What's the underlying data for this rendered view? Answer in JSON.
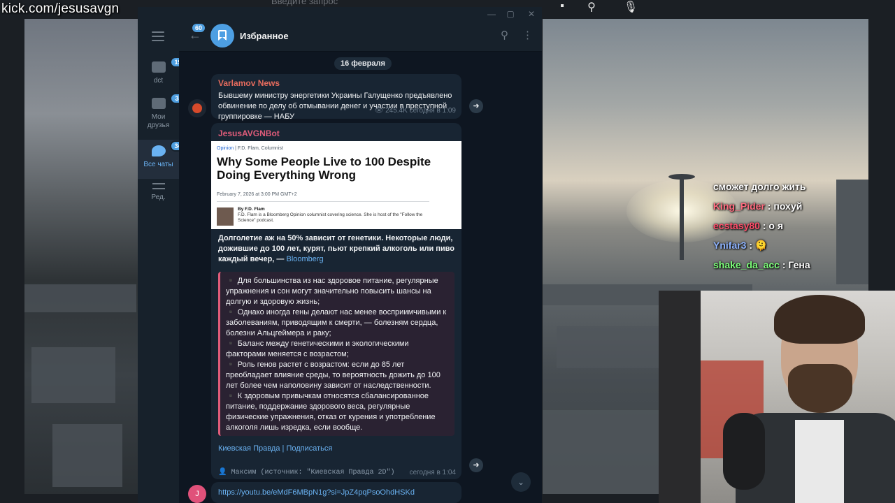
{
  "stream": {
    "watermark": "kick.com/jesusavgn",
    "search_placeholder": "Введите запрос"
  },
  "overlay_chat": {
    "top_line": "сможет долго жить",
    "lines": [
      {
        "user": "King_Pider",
        "sep": " : ",
        "text": "похуй",
        "color": "#ff6b7f"
      },
      {
        "user": "ecstasy80",
        "sep": " : ",
        "text": "о я",
        "color": "#ff4d6a"
      },
      {
        "user": "Ynifar3",
        "sep": " : ",
        "text": "🫠",
        "color": "#8fb4ff"
      },
      {
        "user": "shake_da_acc",
        "sep": " : ",
        "text": "Гена",
        "color": "#7dff7a"
      }
    ]
  },
  "window_controls": {
    "minimize": "—",
    "maximize": "▢",
    "close": "✕"
  },
  "sidebar": {
    "folders": [
      {
        "label": "dct",
        "badge": "190"
      },
      {
        "label": "Мои друзья",
        "badge": "34"
      },
      {
        "label": "Все чаты",
        "badge": "341"
      },
      {
        "label": "Ред.",
        "badge": ""
      }
    ]
  },
  "header": {
    "back_badge": "60",
    "title": "Избранное"
  },
  "messages": {
    "date": "16 февраля",
    "msg1": {
      "sender": "Varlamov News",
      "sender_color": "#e56b5d",
      "text": "Бывшему министру энергетики Украины Галущенко предъявлено обвинение по делу об отмывании денег и участии в преступной группировке — НАБУ",
      "views": "245.4K",
      "time": "сегодня в 1:09"
    },
    "msg2": {
      "sender": "JesusAVGNBot",
      "sender_color": "#e05c7a",
      "article": {
        "kicker_section": "Opinion",
        "kicker_author": " | F.D. Flam, Columnist",
        "title": "Why Some People Live to 100 Despite Doing Everything Wrong",
        "date": "February 7, 2026 at 3:00 PM GMT+2",
        "byline_name": "By F.D. Flam",
        "byline_text": "F.D. Flam is a Bloomberg Opinion columnist covering science. She is host of the \"Follow the Science\" podcast."
      },
      "lead": "Долголетие аж на 50% зависит от генетики. Некоторые люди, дожившие до 100 лет, курят, пьют крепкий алкоголь или пиво каждый вечер, —",
      "lead_link": "Bloomberg",
      "quote_lines": [
        "▪️ Для большинства из нас здоровое питание, регулярные упражнения и сон могут значительно повысить шансы на долгую и здоровую жизнь;",
        "▪️ Однако иногда гены делают нас менее восприимчивыми к заболеваниям, приводящим к смерти, — болезням сердца, болезни Альцгеймера и раку;",
        "▪️ Баланс между генетическими и экологическими факторами меняется с возрастом;",
        "▪️ Роль генов растет с возрастом: если до 85 лет преобладает влияние среды, то вероятность дожить до 100 лет более чем наполовину зависит от наследственности.",
        "▪️ К здоровым привычкам относятся сбалансированное питание, поддержание здорового веса, регулярные физические упражнения, отказ от курения и употребление алкоголя лишь изредка, если вообще."
      ],
      "footer_links": "Киевская Правда | Подписаться",
      "source_line": "👤 Максим (источник: \"Киевская Правда 2D\")",
      "time": "сегодня в 1:04"
    },
    "msg3": {
      "avatar_letter": "J",
      "link": "https://youtu.be/eMdF6MBpN1g?si=JpZ4pqPsoOhdHSKd"
    }
  }
}
